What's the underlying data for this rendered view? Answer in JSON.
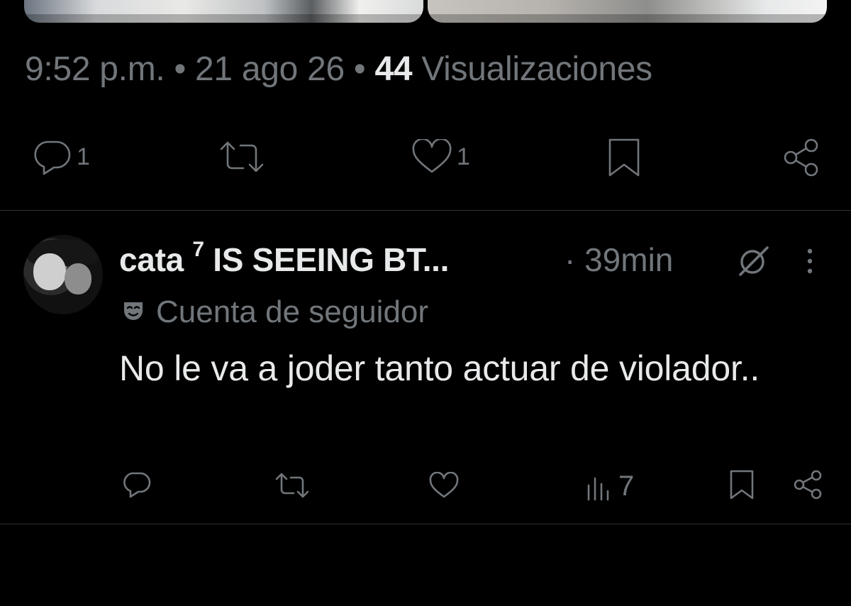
{
  "tweet": {
    "time": "9:52 p.m.",
    "date": "21 ago 26",
    "views_count": "44",
    "views_label": "Visualizaciones",
    "separator": "•",
    "actions": {
      "reply_count": "1",
      "retweet_count": "",
      "like_count": "1"
    }
  },
  "reply": {
    "author_name": "cata",
    "author_superscript": "7",
    "author_suffix": "IS SEEING BT...",
    "time": "· 39min",
    "badge_label": "Cuenta de seguidor",
    "text": "No le va a joder tanto actuar de violador..",
    "actions": {
      "views_count": "7"
    }
  },
  "colors": {
    "background": "#000000",
    "text_primary": "#e7e9ea",
    "text_secondary": "#71767b",
    "divider": "#2f3336"
  },
  "icons": {
    "reply": "reply-icon",
    "retweet": "retweet-icon",
    "like": "heart-icon",
    "bookmark": "bookmark-icon",
    "share": "share-icon",
    "views": "views-icon",
    "grok": "grok-icon",
    "more": "more-vertical-icon",
    "badge": "mask-icon"
  }
}
